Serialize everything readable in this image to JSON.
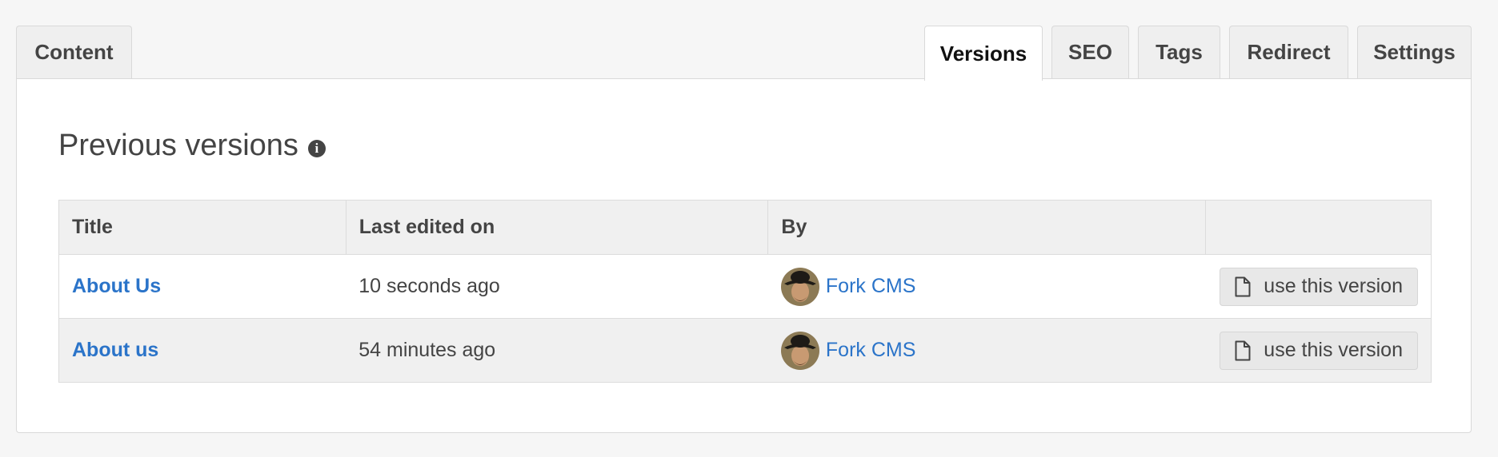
{
  "tabs": {
    "content": "Content",
    "versions": "Versions",
    "seo": "SEO",
    "tags": "Tags",
    "redirect": "Redirect",
    "settings": "Settings",
    "active": "Versions"
  },
  "section": {
    "heading": "Previous versions",
    "info_icon": "info-circle-icon"
  },
  "table": {
    "headers": [
      "Title",
      "Last edited on",
      "By",
      ""
    ],
    "rows": [
      {
        "title": "About Us",
        "edited": "10 seconds ago",
        "author": "Fork CMS",
        "action": "use this version"
      },
      {
        "title": "About us",
        "edited": "54 minutes ago",
        "author": "Fork CMS",
        "action": "use this version"
      }
    ]
  },
  "colors": {
    "link": "#2b74c9",
    "header_bg": "#f0f0f0",
    "page_bg": "#f6f6f6"
  }
}
